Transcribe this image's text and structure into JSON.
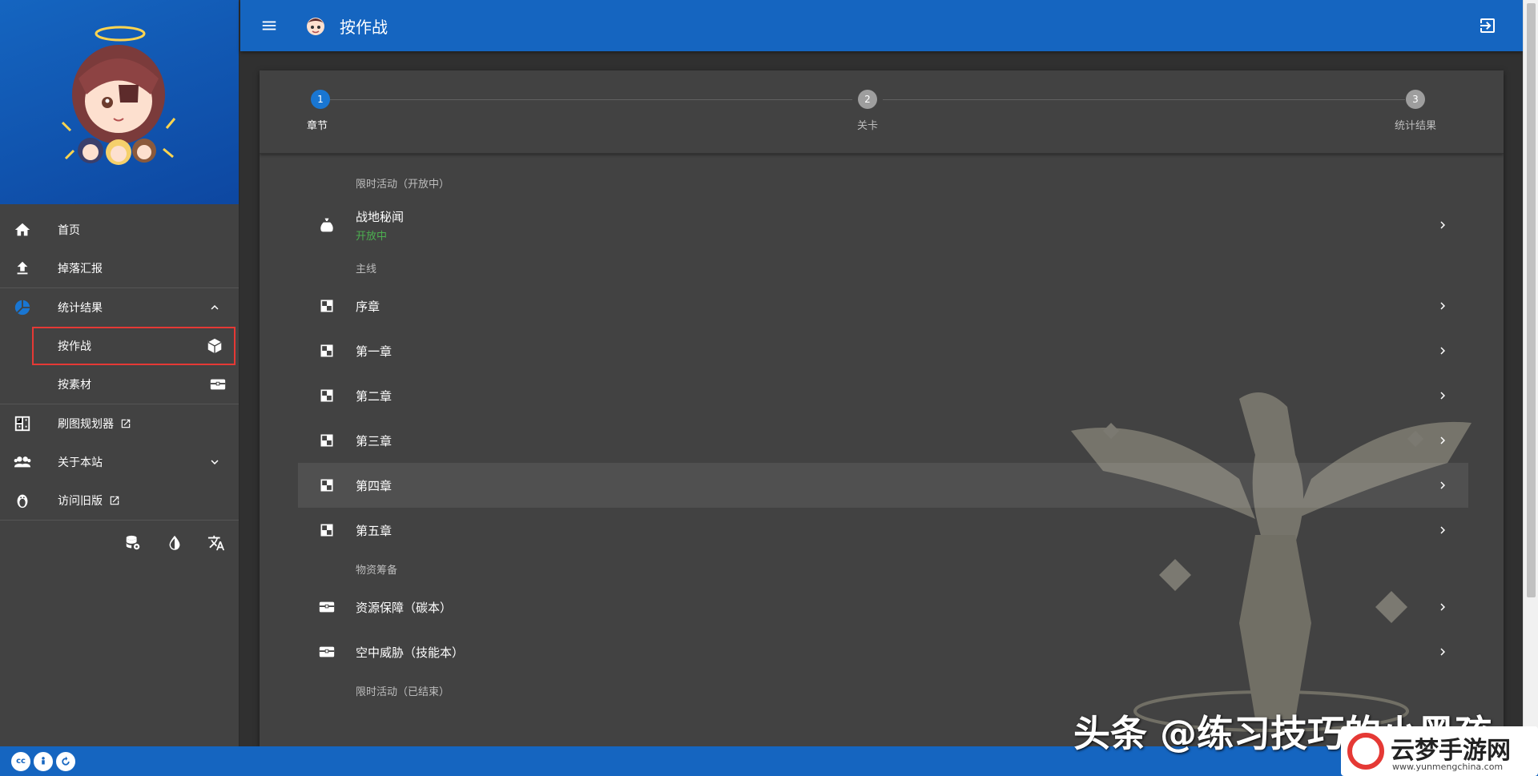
{
  "app": {
    "title": "按作战"
  },
  "sidebar": {
    "items": [
      {
        "label": "首页",
        "icon": "home-icon"
      },
      {
        "label": "掉落汇报",
        "icon": "upload-icon"
      },
      {
        "label": "统计结果",
        "icon": "pie-chart-icon",
        "expanded": true
      },
      {
        "label": "按作战",
        "icon": "cube-icon",
        "active": true
      },
      {
        "label": "按素材",
        "icon": "treasure-chest-icon"
      },
      {
        "label": "刷图规划器",
        "icon": "planner-icon",
        "external": true
      },
      {
        "label": "关于本站",
        "icon": "people-icon"
      },
      {
        "label": "访问旧版",
        "icon": "penguin-icon",
        "external": true
      }
    ],
    "tools": [
      "database-settings-icon",
      "theme-drop-icon",
      "translate-icon"
    ]
  },
  "stepper": {
    "steps": [
      {
        "number": "1",
        "label": "章节",
        "active": true
      },
      {
        "number": "2",
        "label": "关卡",
        "active": false
      },
      {
        "number": "3",
        "label": "统计结果",
        "active": false
      }
    ]
  },
  "list": {
    "sections": [
      {
        "header": "限时活动（开放中）",
        "rows": [
          {
            "label": "战地秘闻",
            "status": "开放中",
            "icon": "money-bag-icon"
          }
        ]
      },
      {
        "header": "主线",
        "rows": [
          {
            "label": "序章",
            "icon": "checker-icon"
          },
          {
            "label": "第一章",
            "icon": "checker-icon"
          },
          {
            "label": "第二章",
            "icon": "checker-icon"
          },
          {
            "label": "第三章",
            "icon": "checker-icon"
          },
          {
            "label": "第四章",
            "icon": "checker-icon",
            "highlighted": true
          },
          {
            "label": "第五章",
            "icon": "checker-icon"
          }
        ]
      },
      {
        "header": "物资筹备",
        "rows": [
          {
            "label": "资源保障（碳本）",
            "icon": "treasure-chest-icon"
          },
          {
            "label": "空中威胁（技能本）",
            "icon": "treasure-chest-icon"
          }
        ]
      },
      {
        "header": "限时活动（已结束）",
        "rows": []
      }
    ]
  },
  "colors": {
    "primary": "#1565c0",
    "active_step": "#1976d2",
    "status_green": "#4caf50",
    "highlight_border": "#e53935"
  },
  "watermark": {
    "text": "头条 @练习技巧的小黑孩",
    "logo_text": "云梦手游网",
    "logo_url": "www.yunmengchina.com"
  }
}
